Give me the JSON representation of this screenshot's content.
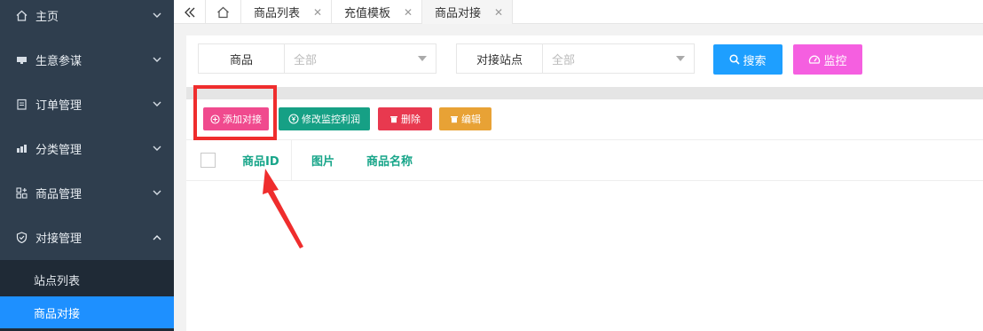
{
  "sidebar": {
    "items": [
      {
        "label": "主页",
        "icon": "home-icon"
      },
      {
        "label": "生意参谋",
        "icon": "monitor-icon"
      },
      {
        "label": "订单管理",
        "icon": "clipboard-icon"
      },
      {
        "label": "分类管理",
        "icon": "layers-icon"
      },
      {
        "label": "商品管理",
        "icon": "grid-icon"
      },
      {
        "label": "对接管理",
        "icon": "shield-icon"
      }
    ],
    "subitems": [
      {
        "label": "站点列表"
      },
      {
        "label": "商品对接"
      }
    ]
  },
  "tabs": [
    {
      "label": "商品列表"
    },
    {
      "label": "充值模板"
    },
    {
      "label": "商品对接"
    }
  ],
  "filters": {
    "product_label": "商品",
    "product_value": "全部",
    "site_label": "对接站点",
    "site_value": "全部"
  },
  "buttons": {
    "search": "搜索",
    "monitor": "监控",
    "add": "添加对接",
    "modify": "修改监控利润",
    "delete": "删除",
    "edit": "编辑"
  },
  "table": {
    "columns": [
      "商品ID",
      "图片",
      "商品名称"
    ]
  },
  "colors": {
    "sidebar_bg": "#2f3e4e",
    "active_blue": "#1e90ff",
    "search_blue": "#1e9fff",
    "monitor_pink": "#f55fe0",
    "add_pink": "#f04a8e",
    "modify_green": "#16a085",
    "delete_red": "#e8394f",
    "edit_orange": "#e8a235",
    "header_teal": "#17a589",
    "annotation_red": "#ef2d2d"
  }
}
